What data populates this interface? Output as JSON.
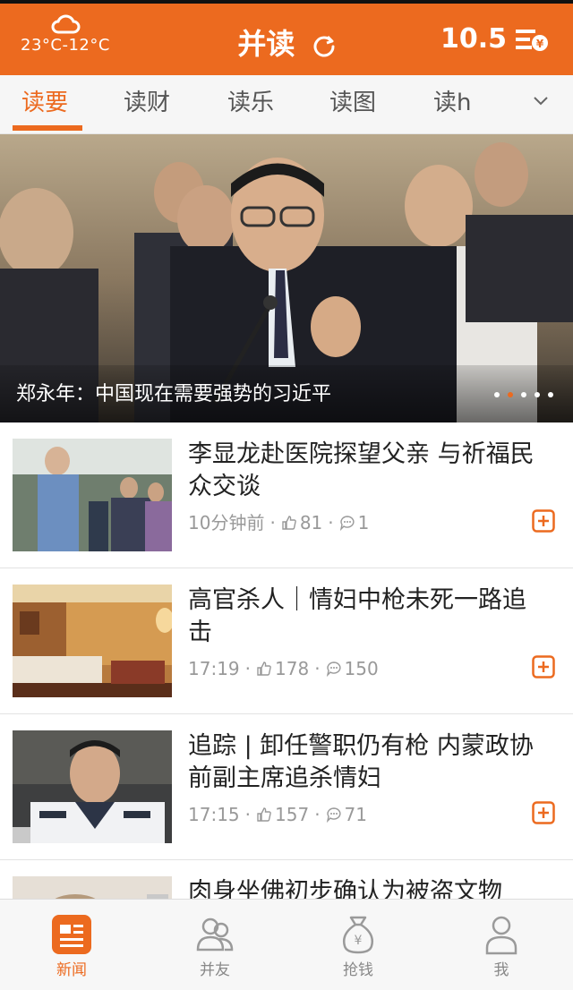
{
  "header": {
    "weather_icon": "cloud-icon",
    "temperature": "23°C-12°C",
    "title": "并读",
    "refresh_icon": "refresh-icon",
    "balance": "10.5",
    "wallet_icon": "coin-menu-icon",
    "bg_color": "#ec6a1f"
  },
  "tabs": {
    "items": [
      {
        "label": "读要",
        "active": true
      },
      {
        "label": "读财"
      },
      {
        "label": "读乐"
      },
      {
        "label": "读图"
      },
      {
        "label": "读h"
      }
    ],
    "more_icon": "chevron-down-icon"
  },
  "banner": {
    "caption": "郑永年：中国现在需要强势的习近平",
    "slides": 5,
    "active_slide": 2
  },
  "news": [
    {
      "title": "李显龙赴医院探望父亲 与祈福民众交谈",
      "time": "10分钟前",
      "likes": "81",
      "comments": "1"
    },
    {
      "title": "高官杀人｜情妇中枪未死一路追击",
      "time": "17:19",
      "likes": "178",
      "comments": "150"
    },
    {
      "title": "追踪 | 卸任警职仍有枪 内蒙政协前副主席追杀情妇",
      "time": "17:15",
      "likes": "157",
      "comments": "71"
    },
    {
      "title": "肉身坐佛初步确认为被盗文物",
      "time": "",
      "likes": "",
      "comments": ""
    }
  ],
  "bottom_nav": [
    {
      "label": "新闻",
      "icon": "news-icon",
      "active": true
    },
    {
      "label": "并友",
      "icon": "friends-icon"
    },
    {
      "label": "抢钱",
      "icon": "money-bag-icon"
    },
    {
      "label": "我",
      "icon": "profile-icon"
    }
  ]
}
